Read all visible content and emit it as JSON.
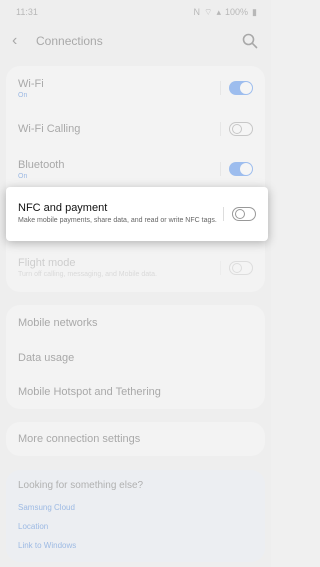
{
  "status_bar": {
    "time": "11:31",
    "battery": "100%"
  },
  "header": {
    "title": "Connections",
    "back_icon": "back-arrow-icon",
    "search_icon": "search-icon"
  },
  "rows_top": [
    {
      "label": "Wi-Fi",
      "sub": "On",
      "toggle": "on"
    },
    {
      "label": "Wi-Fi Calling",
      "sub": "",
      "toggle": "off"
    },
    {
      "label": "Bluetooth",
      "sub": "On",
      "toggle": "on"
    }
  ],
  "nfc": {
    "title": "NFC and payment",
    "desc": "Make mobile payments, share data, and read or write NFC tags.",
    "toggle": "off"
  },
  "flight": {
    "label": "Flight mode",
    "desc": "Turn off calling, messaging, and Mobile data.",
    "toggle": "off"
  },
  "menu": [
    "Mobile networks",
    "Data usage",
    "Mobile Hotspot and Tethering"
  ],
  "more": "More connection settings",
  "looking": {
    "title": "Looking for something else?",
    "links": [
      "Samsung Cloud",
      "Location",
      "Link to Windows"
    ]
  }
}
